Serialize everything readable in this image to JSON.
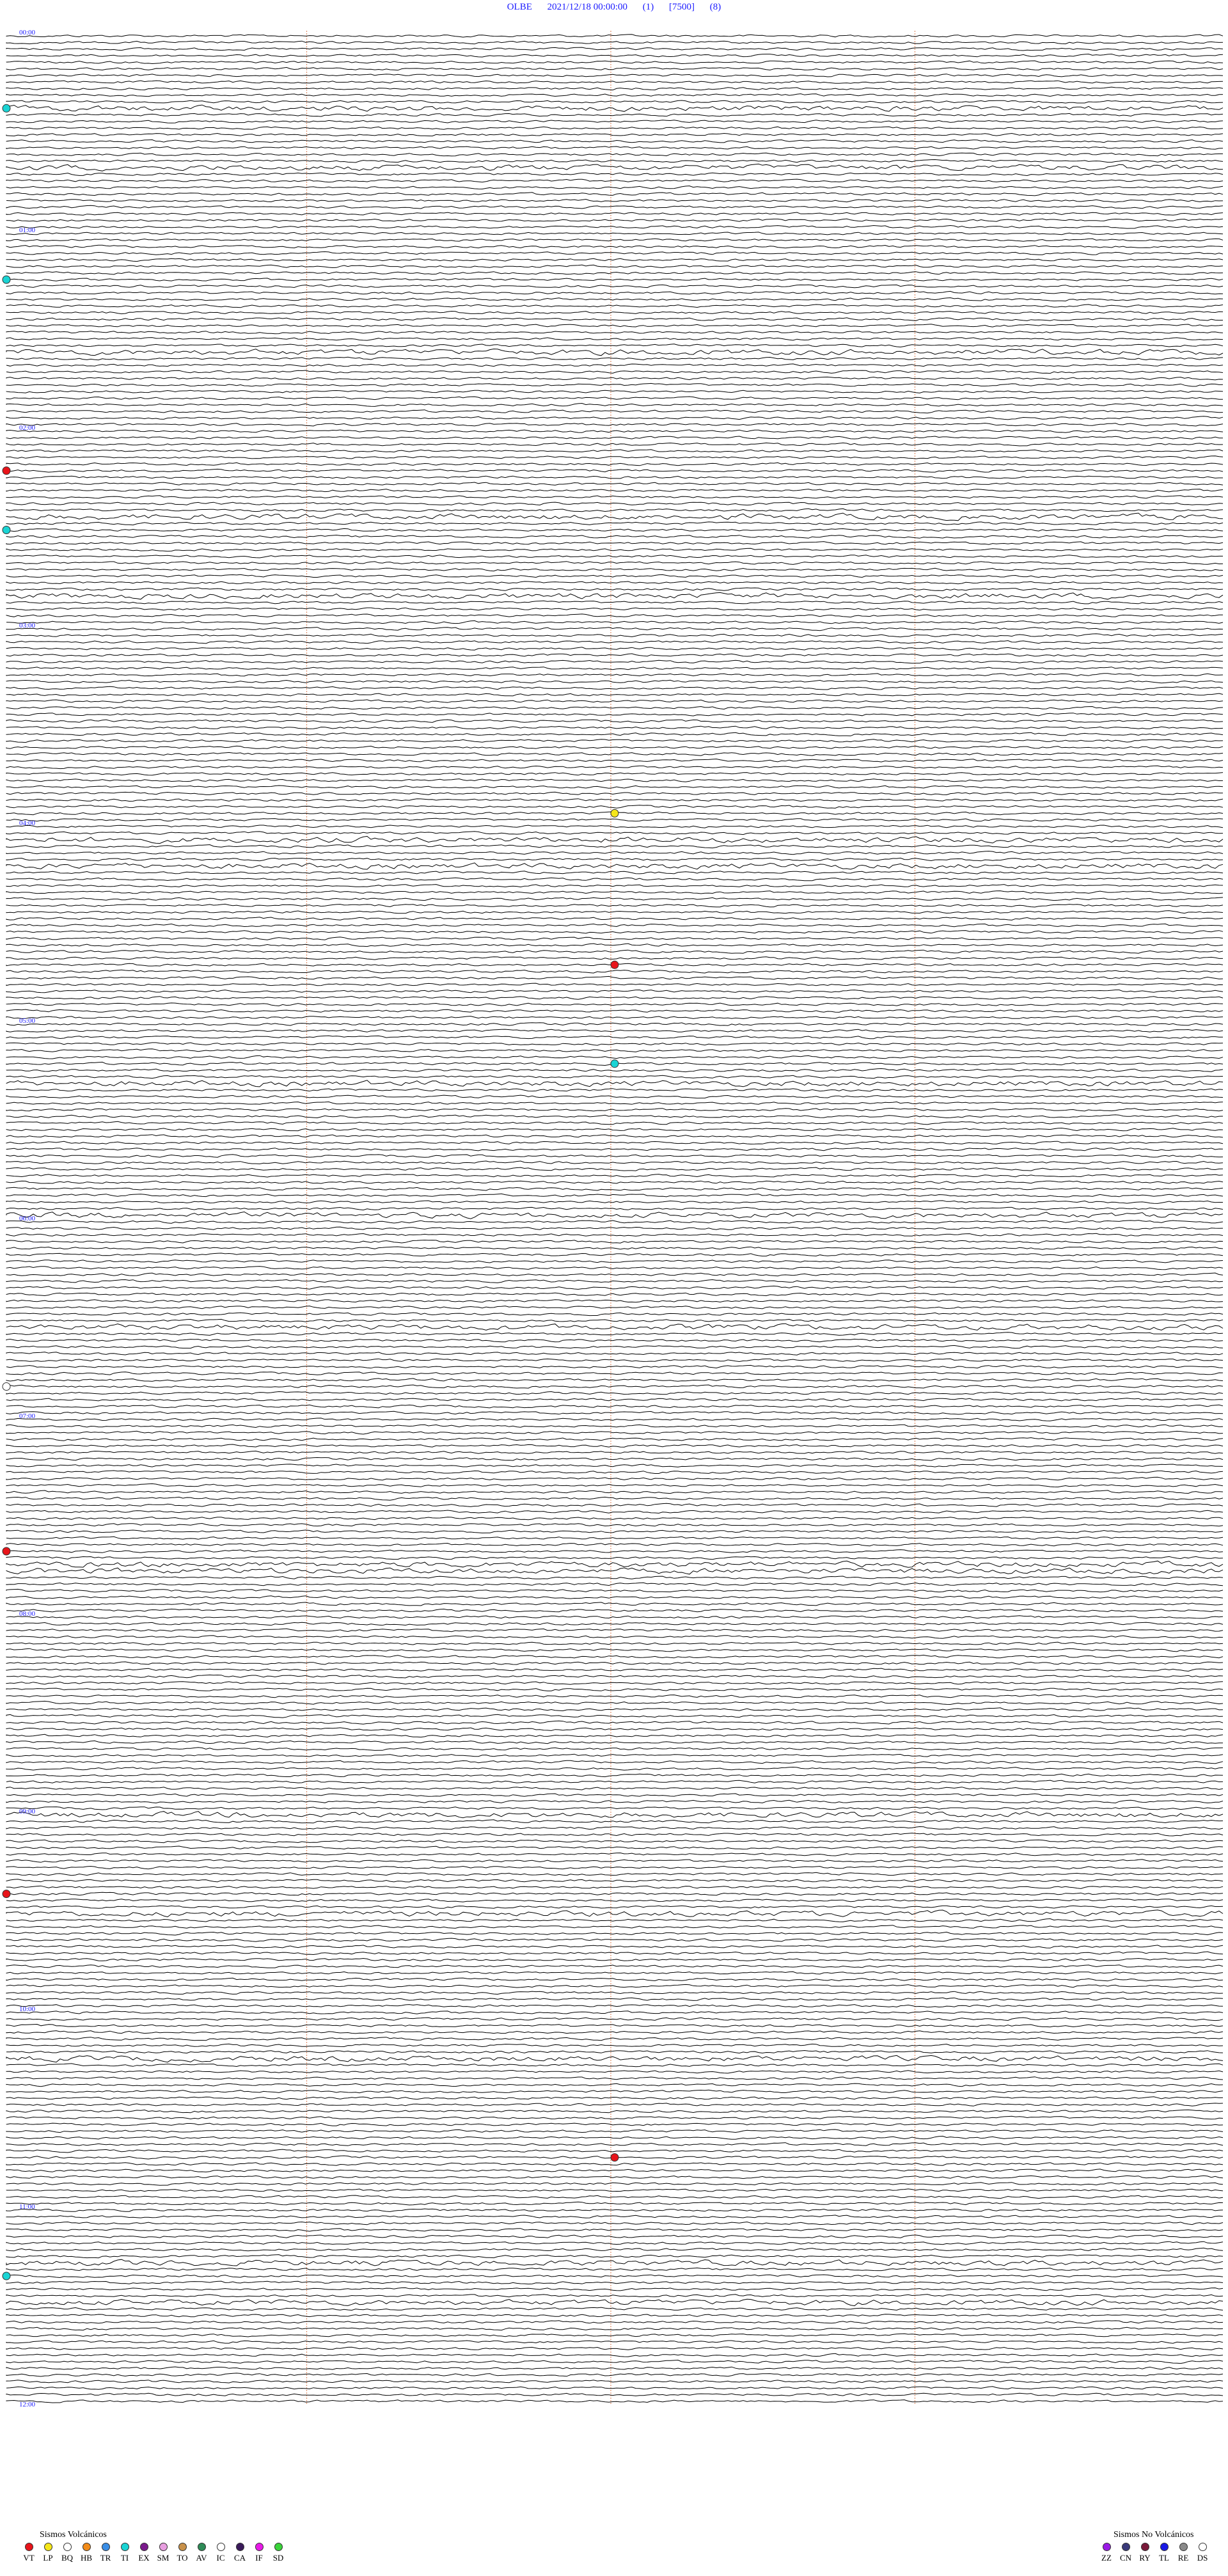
{
  "header": {
    "station": "OLBE",
    "datetime": "2021/12/18 00:00:00",
    "channel": "(1)",
    "gain": "[7500]",
    "scale": "(8)"
  },
  "chart_data": {
    "type": "seismogram",
    "hour_labels": [
      "00:00",
      "01:00",
      "02:00",
      "03:00",
      "04:00",
      "05:00",
      "06:00",
      "07:00",
      "08:00",
      "09:00",
      "10:00",
      "11:00",
      "12:00"
    ],
    "rows_per_hour": 30,
    "total_rows": 360,
    "minute_markers": [
      15,
      30,
      45
    ],
    "minute_marker_color": "#e2916b",
    "trace_color": "#000000",
    "label_color": "#1a1aff",
    "events": [
      {
        "hour": 0,
        "minute": 22,
        "type": "TI"
      },
      {
        "hour": 1,
        "minute": 14,
        "type": "TI"
      },
      {
        "hour": 2,
        "minute": 12,
        "type": "VT"
      },
      {
        "hour": 2,
        "minute": 30,
        "type": "TI"
      },
      {
        "hour": 3,
        "minute": 57,
        "type": "LP"
      },
      {
        "hour": 4,
        "minute": 43,
        "type": "VT"
      },
      {
        "hour": 5,
        "minute": 13,
        "type": "TI"
      },
      {
        "hour": 6,
        "minute": 50,
        "type": "BQ"
      },
      {
        "hour": 7,
        "minute": 40,
        "type": "VT"
      },
      {
        "hour": 9,
        "minute": 24,
        "type": "VT"
      },
      {
        "hour": 10,
        "minute": 45,
        "type": "VT"
      },
      {
        "hour": 11,
        "minute": 20,
        "type": "TI"
      }
    ]
  },
  "legend_volcanic": {
    "title": "Sismos Volcánicos",
    "items": [
      {
        "code": "VT",
        "color": "#e8141a"
      },
      {
        "code": "LP",
        "color": "#f5e61a"
      },
      {
        "code": "BQ",
        "color": "#ffffff"
      },
      {
        "code": "HB",
        "color": "#f28c1a"
      },
      {
        "code": "TR",
        "color": "#3a8ee6"
      },
      {
        "code": "TI",
        "color": "#1ad4d4"
      },
      {
        "code": "EX",
        "color": "#7a1a8c"
      },
      {
        "code": "SM",
        "color": "#e89ee0"
      },
      {
        "code": "TO",
        "color": "#c8914a"
      },
      {
        "code": "AV",
        "color": "#2e8b57"
      },
      {
        "code": "IC",
        "color": "#ffffff"
      },
      {
        "code": "CA",
        "color": "#3a1a5a"
      },
      {
        "code": "IF",
        "color": "#e81ae8"
      },
      {
        "code": "SD",
        "color": "#3ad43a"
      }
    ]
  },
  "legend_nonvolcanic": {
    "title": "Sismos No Volcánicos",
    "items": [
      {
        "code": "ZZ",
        "color": "#9a1ae6"
      },
      {
        "code": "CN",
        "color": "#3a3a7a"
      },
      {
        "code": "RY",
        "color": "#7a1a3a"
      },
      {
        "code": "TL",
        "color": "#1a1ae6"
      },
      {
        "code": "RE",
        "color": "#8a8a8a"
      },
      {
        "code": "DS",
        "color": "#ffffff"
      }
    ]
  }
}
